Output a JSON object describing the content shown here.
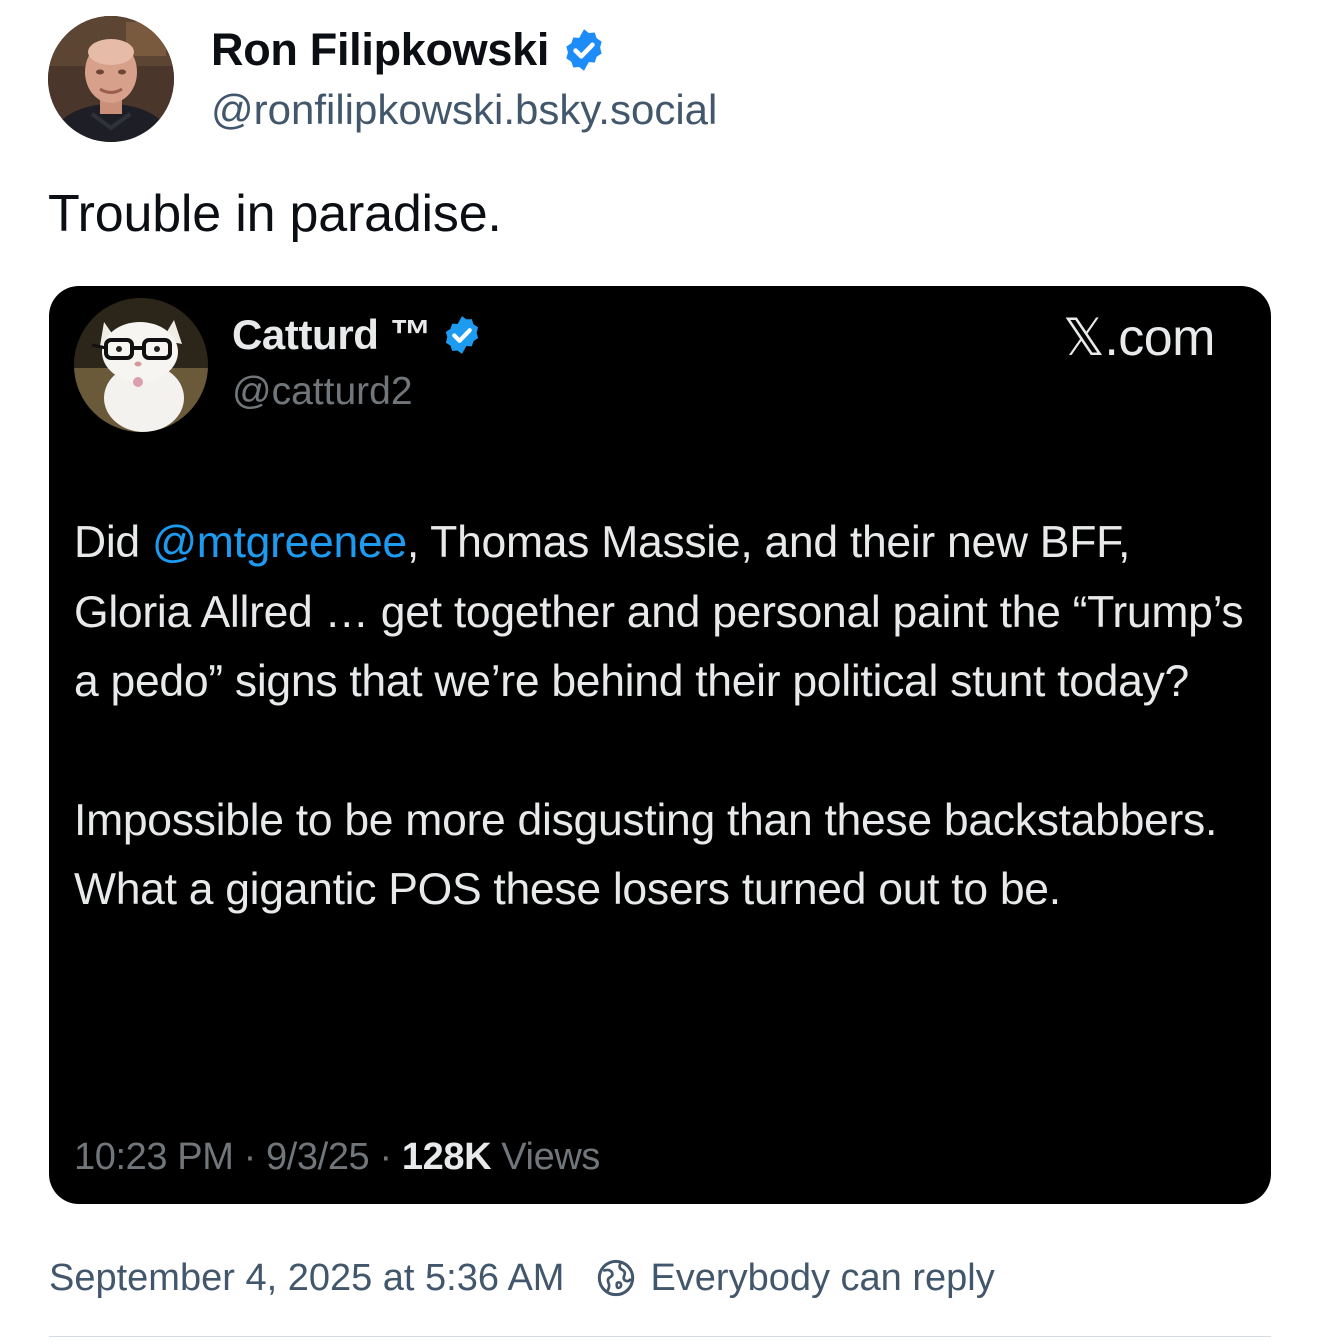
{
  "post": {
    "author_name": "Ron Filipkowski",
    "author_handle": "@ronfilipkowski.bsky.social",
    "text": "Trouble in paradise.",
    "timestamp": "September 4, 2025 at 5:36 AM",
    "reply_setting": "Everybody can reply",
    "verified": true
  },
  "embed": {
    "author_name": "Catturd ™",
    "author_handle": "@catturd2",
    "brand_mark": "𝕏",
    "brand_suffix": ".com",
    "body": {
      "para1_prefix": "Did ",
      "para1_mention": "@mtgreenee",
      "para1_rest": ", Thomas Massie, and their new BFF, Gloria Allred … get together and personal paint the “Trump’s a pedo” signs that we’re behind their political stunt today?",
      "para2": "Impossible to be more disgusting than these backstabbers. What a gigantic POS these losers turned out to be."
    },
    "meta": {
      "time": "10:23 PM",
      "separator": " · ",
      "date": "9/3/25",
      "views_count": "128K",
      "views_label": " Views"
    }
  },
  "icons": {
    "verified": "verified-check-icon",
    "reply_setting": "globe-earth-icon"
  },
  "colors": {
    "verified_blue": "#1d8cf8",
    "mention_blue": "#1d9bf0",
    "secondary_text": "#42576c",
    "card_background": "#000000"
  }
}
